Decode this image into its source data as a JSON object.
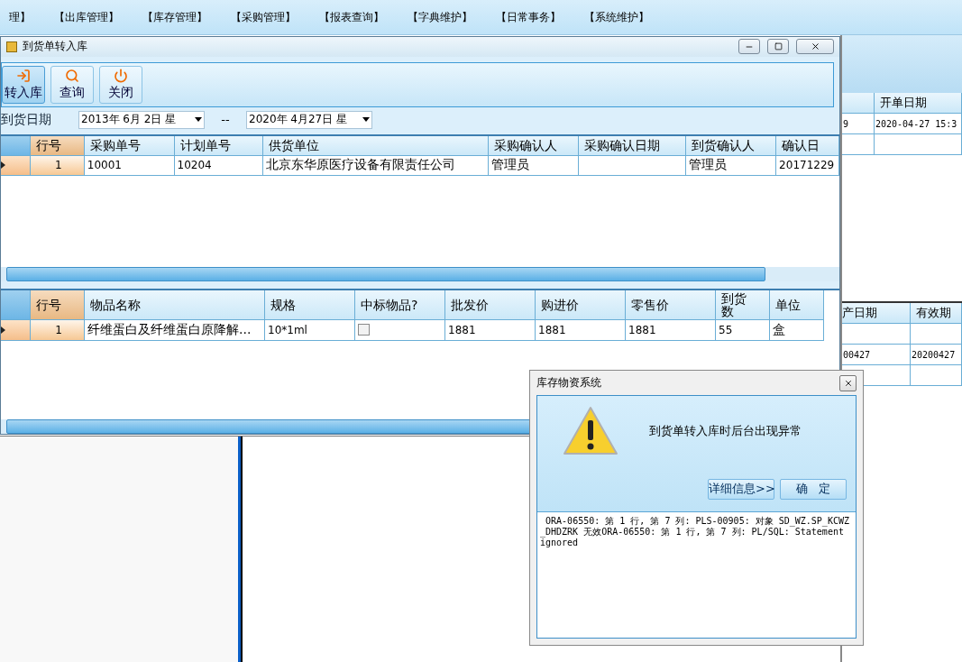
{
  "menu_bar": {
    "items": [
      "理】",
      "【出库管理】",
      "【库存管理】",
      "【采购管理】",
      "【报表查询】",
      "【字典维护】",
      "【日常事务】",
      "【系统维护】"
    ]
  },
  "background_window": {
    "top_grid": {
      "columns": [
        "",
        "开单日期"
      ],
      "rows": [
        {
          "cells": [
            "9",
            "2020-04-27 15:3"
          ]
        }
      ]
    },
    "bottom_grid": {
      "columns": [
        "产日期",
        "有效期"
      ],
      "rows": [
        {
          "cells": [
            "00427",
            "20200427"
          ]
        }
      ]
    }
  },
  "child_window": {
    "title": "到货单转入库",
    "toolbar": [
      {
        "label": "转入库",
        "selected": true
      },
      {
        "label": "查询",
        "selected": false
      },
      {
        "label": "关闭",
        "selected": false
      }
    ],
    "filter": {
      "label": "到货日期",
      "from": "2013年 6月 2日 星",
      "separator": "--",
      "to": "2020年 4月27日 星"
    },
    "order_grid": {
      "columns": [
        "行号",
        "采购单号",
        "计划单号",
        "供货单位",
        "采购确认人",
        "采购确认日期",
        "到货确认人",
        "确认日"
      ],
      "rows": [
        {
          "current": true,
          "cells": [
            "1",
            "10001",
            "10204",
            "北京东华原医疗设备有限责任公司",
            "管理员",
            "",
            "管理员",
            "20171229"
          ]
        }
      ]
    },
    "item_grid": {
      "columns": [
        {
          "label": "行号",
          "kind": "text"
        },
        {
          "label": "物品名称",
          "kind": "text"
        },
        {
          "label": "规格",
          "kind": "text"
        },
        {
          "label": "中标物品?",
          "kind": "check"
        },
        {
          "label": "批发价",
          "kind": "text"
        },
        {
          "label": "购进价",
          "kind": "text"
        },
        {
          "label": "零售价",
          "kind": "text"
        },
        {
          "label": "到货数",
          "kind": "text"
        },
        {
          "label": "单位",
          "kind": "text"
        }
      ],
      "rows": [
        {
          "current": true,
          "checked": false,
          "cells": [
            "1",
            "纤维蛋白及纤维蛋白原降解...",
            "10*1ml",
            "",
            "1881",
            "1881",
            "1881",
            "55",
            "盒"
          ]
        }
      ]
    }
  },
  "dialog": {
    "title": "库存物资系统",
    "message": "到货单转入库时后台出现异常",
    "buttons": [
      "详细信息>>",
      "确   定"
    ],
    "details": " ORA-06550: 第 1 行, 第 7 列: PLS-00905: 对象 SD_WZ.SP_KCWZ_DHDZRK 无效ORA-06550: 第 1 行, 第 7 列: PL/SQL: Statement ignored"
  }
}
